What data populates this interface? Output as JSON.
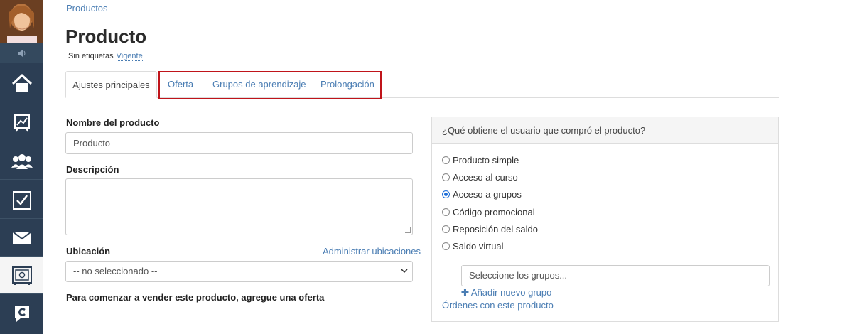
{
  "breadcrumb": "Productos",
  "page": {
    "title": "Producto",
    "tags_label": "Sin etiquetas",
    "status": "Vigente"
  },
  "tabs": [
    {
      "label": "Ajustes principales",
      "active": true
    },
    {
      "label": "Oferta"
    },
    {
      "label": "Grupos de aprendizaje"
    },
    {
      "label": "Prolongación"
    }
  ],
  "form": {
    "name_label": "Nombre del producto",
    "name_value": "Producto",
    "description_label": "Descripción",
    "description_value": "",
    "location_label": "Ubicación",
    "location_manage_link": "Administrar ubicaciones",
    "location_value": "-- no seleccionado --",
    "hint": "Para comenzar a vender este producto, agregue una oferta"
  },
  "panel": {
    "question": "¿Qué obtiene el usuario que compró el producto?",
    "options": [
      {
        "label": "Producto simple",
        "selected": false
      },
      {
        "label": "Acceso al curso",
        "selected": false
      },
      {
        "label": "Acceso a grupos",
        "selected": true
      },
      {
        "label": "Código promocional",
        "selected": false
      },
      {
        "label": "Reposición del saldo",
        "selected": false
      },
      {
        "label": "Saldo virtual",
        "selected": false
      }
    ],
    "groups_placeholder": "Seleccione los grupos...",
    "add_group": "Añadir nuevo grupo",
    "orders_link": "Órdenes con este producto"
  },
  "sidebar": {
    "icons": [
      "volume-icon",
      "home-icon",
      "chart-icon",
      "users-icon",
      "checkbox-icon",
      "mail-icon",
      "safe-icon",
      "chat-logo-icon"
    ],
    "active": "safe-icon"
  },
  "colors": {
    "sidebar_bg": "#2c3e54",
    "link": "#4a7db3",
    "highlight_border": "#c0141a"
  }
}
